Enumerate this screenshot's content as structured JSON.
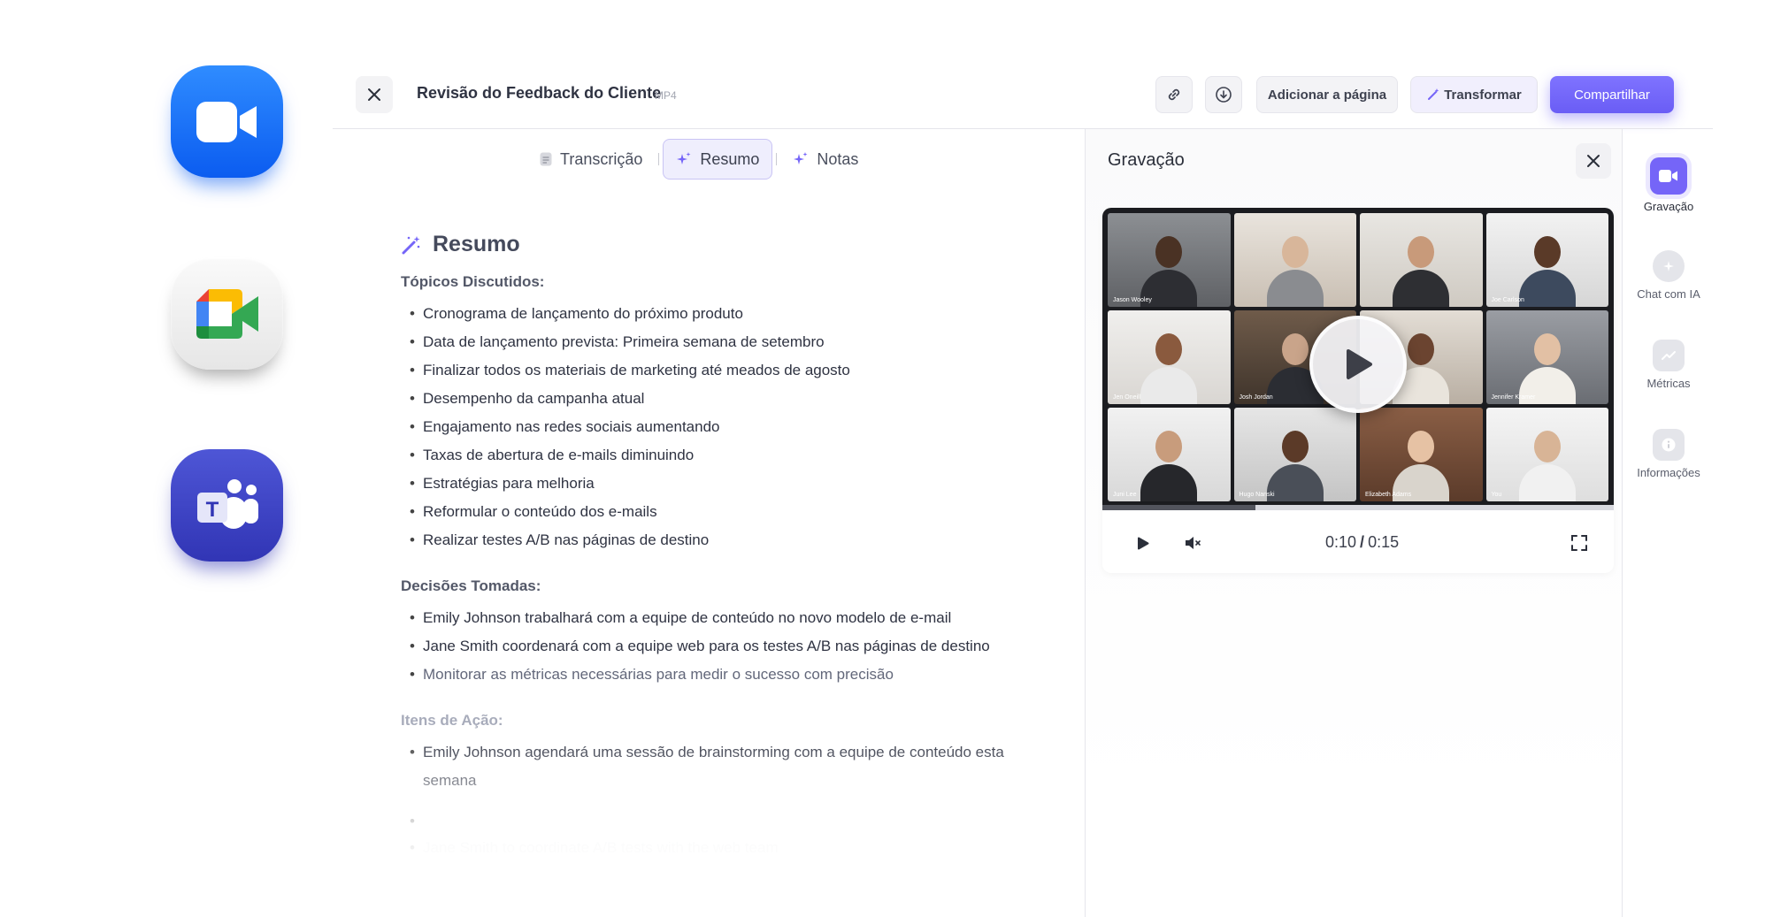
{
  "apps": [
    {
      "name": "Zoom",
      "color": "#0b5cf0"
    },
    {
      "name": "Google Meet",
      "color": "#e6e6e6"
    },
    {
      "name": "Microsoft Teams",
      "color": "#3135b5"
    }
  ],
  "header": {
    "title": "Revisão do Feedback do Cliente",
    "badge": "MP4",
    "add_page_label": "Adicionar a página",
    "transform_label": "Transformar",
    "share_label": "Compartilhar",
    "share_color": "#6a5df5"
  },
  "tabs": [
    {
      "label": "Transcrição",
      "active": false
    },
    {
      "label": "Resumo",
      "active": true
    },
    {
      "label": "Notas",
      "active": false
    }
  ],
  "summary": {
    "heading": "Resumo",
    "topics_title": "Tópicos Discutidos:",
    "topics": [
      "Cronograma de lançamento do próximo produto",
      "Data de lançamento prevista: Primeira semana de setembro",
      "Finalizar todos os materiais de marketing até meados de agosto",
      "Desempenho da campanha atual",
      "Engajamento nas redes sociais aumentando",
      "Taxas de abertura de e-mails diminuindo",
      "Estratégias para melhoria",
      "Reformular o conteúdo dos e-mails",
      "Realizar testes A/B nas páginas de destino"
    ],
    "decisions_title": "Decisões Tomadas:",
    "decisions": [
      "Emily Johnson trabalhará com a equipe de conteúdo no novo modelo de e-mail",
      "Jane Smith coordenará com a equipe web para os testes A/B nas páginas de destino",
      "Monitorar as métricas necessárias para medir o sucesso com precisão"
    ],
    "actions_title": "Itens de Ação:",
    "actions": [
      "Emily Johnson agendará uma sessão de brainstorming com a equipe de conteúdo esta semana",
      "",
      "Jane Smith to coordinate A/B tests with the web team"
    ]
  },
  "recording": {
    "title": "Gravação",
    "participants": [
      "Jason Wooley",
      "",
      "",
      "Joe Carlson",
      "Jen Oneill",
      "Josh Jordan",
      "",
      "Jennifer Kramer",
      "Juni Lee",
      "Hugo Nanski",
      "Elizabeth Adams",
      "You"
    ],
    "time_current": "0:10",
    "time_separator": "/",
    "time_total": "0:15",
    "progress": 0.3
  },
  "rail": [
    {
      "label": "Gravação",
      "icon": "video-camera-icon",
      "active": true
    },
    {
      "label": "Chat com IA",
      "icon": "ai-chat-icon",
      "active": false
    },
    {
      "label": "Métricas",
      "icon": "metrics-icon",
      "active": false
    },
    {
      "label": "Informações",
      "icon": "info-icon",
      "active": false
    }
  ]
}
